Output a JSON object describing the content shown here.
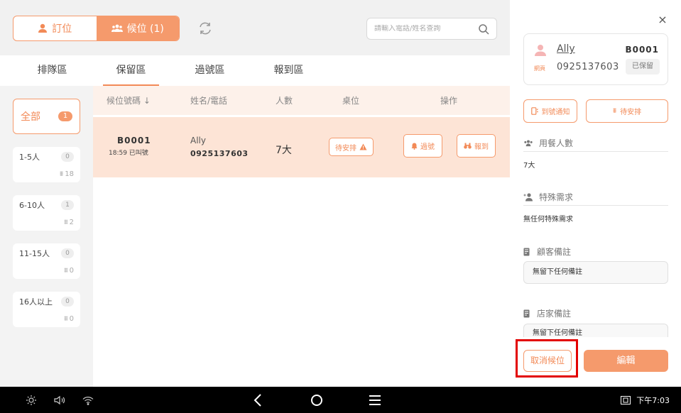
{
  "topbar": {
    "seg_booking": "訂位",
    "seg_waitlist": "候位 (1)",
    "search_placeholder": "請輸入電話/姓名查詢"
  },
  "tabs": [
    "排隊區",
    "保留區",
    "過號區",
    "報到區"
  ],
  "categories": {
    "all": {
      "label": "全部",
      "count": "1"
    },
    "items": [
      {
        "label": "1-5人",
        "count": "0",
        "sub": "18"
      },
      {
        "label": "6-10人",
        "count": "1",
        "sub": "2"
      },
      {
        "label": "11-15人",
        "count": "0",
        "sub": "0"
      },
      {
        "label": "16人以上",
        "count": "0",
        "sub": "0"
      }
    ]
  },
  "table": {
    "headers": {
      "code": "候位號碼 ↓",
      "name": "姓名/電話",
      "people": "人數",
      "table": "桌位",
      "action": "操作"
    },
    "rows": [
      {
        "code": "B0001",
        "time": "18:59 已叫號",
        "name": "Ally",
        "phone": "0925137603",
        "people": "7大",
        "table_btn": "待安排",
        "skip_btn": "過號",
        "checkin_btn": "報到"
      }
    ]
  },
  "panel": {
    "close": "×",
    "guest": {
      "name": "Ally",
      "code": "B0001",
      "tag": "網頁",
      "phone": "0925137603",
      "status": "已保留"
    },
    "notify_btn": "到號通知",
    "arrange_btn": "待安排",
    "diners_title": "用餐人數",
    "diners_value": "7大",
    "special_title": "特殊需求",
    "special_value": "無任何特殊需求",
    "customer_note_title": "顧客備註",
    "customer_note_value": "無留下任何備註",
    "store_note_title": "店家備註",
    "store_note_value": "無留下任何備註",
    "cancel_btn": "取消候位",
    "edit_btn": "編輯"
  },
  "navbar": {
    "time": "下午7:03"
  },
  "colors": {
    "accent": "#f59a6c",
    "accent_text": "#f28a57",
    "highlight": "#e30000",
    "row_bg": "#fde4d6"
  }
}
